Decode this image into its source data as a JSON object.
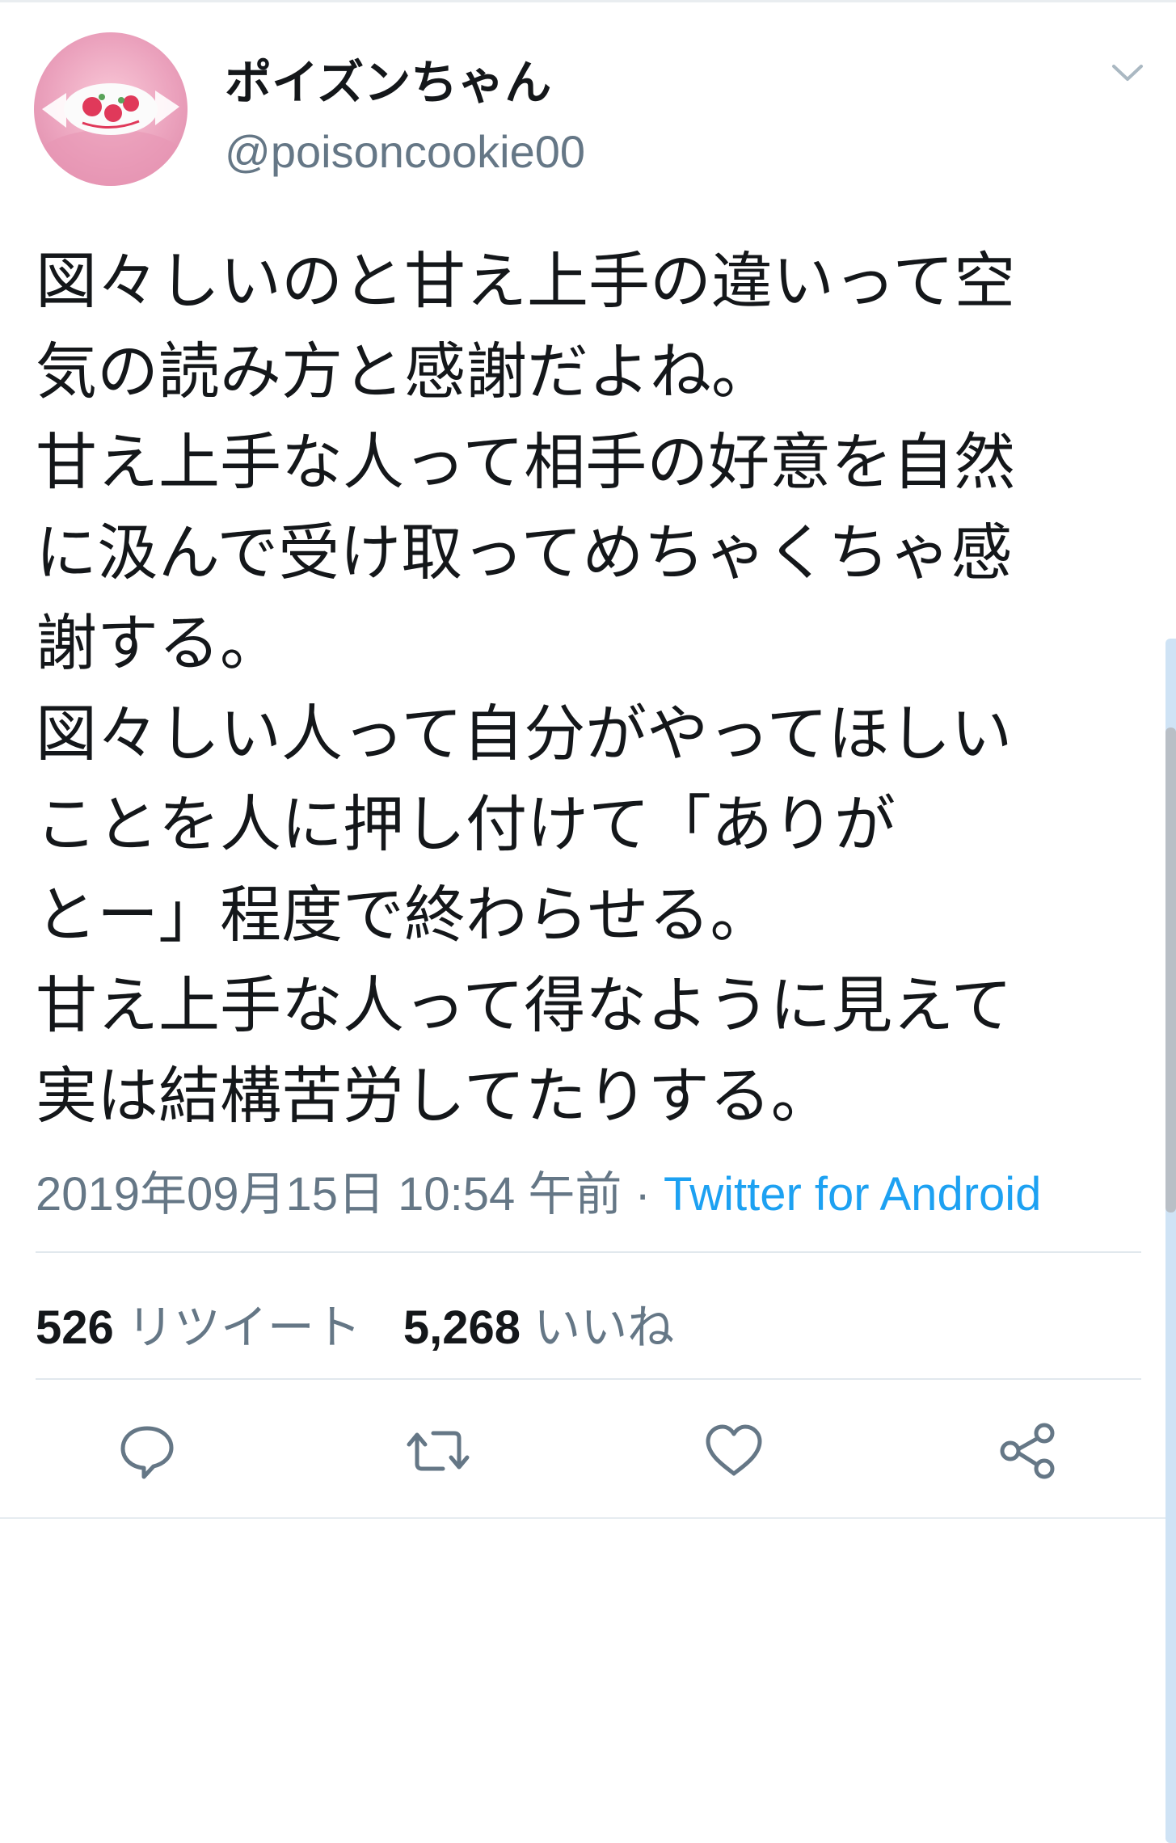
{
  "tweet": {
    "display_name": "ポイズンちゃん",
    "handle": "@poisoncookie00",
    "text_lines": [
      "図々しいのと甘え上手の違いって空",
      "気の読み方と感謝だよね。",
      "甘え上手な人って相手の好意を自然",
      "に汲んで受け取ってめちゃくちゃ感",
      "謝する。",
      "図々しい人って自分がやってほしい",
      "ことを人に押し付けて「ありが",
      "とー」程度で終わらせる。",
      "甘え上手な人って得なように見えて",
      "実は結構苦労してたりする。"
    ],
    "timestamp": "2019年09月15日 10:54 午前",
    "separator": " · ",
    "source": "Twitter for Android",
    "retweet_count": "526",
    "retweet_label": "リツイート",
    "like_count": "5,268",
    "like_label": "いいね"
  },
  "icons": {
    "menu": "chevron-down-icon",
    "reply": "reply-icon",
    "retweet": "retweet-icon",
    "like": "heart-icon",
    "share": "share-icon",
    "avatar": "candy-avatar"
  },
  "colors": {
    "text": "#14171a",
    "secondary": "#657786",
    "link": "#1da1f2",
    "divider": "#e1e8ed",
    "avatar_bg": "#eba2bd"
  }
}
